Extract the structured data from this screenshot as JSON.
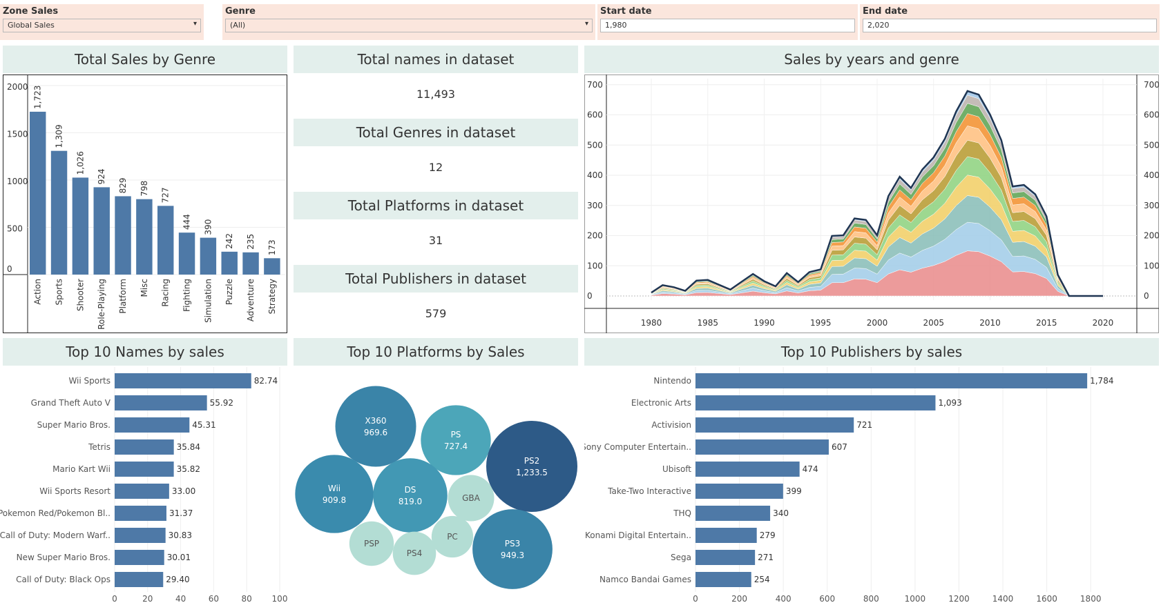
{
  "filters": {
    "zone": {
      "label": "Zone Sales",
      "value": "Global Sales"
    },
    "genre": {
      "label": "Genre",
      "value": "(All)"
    },
    "start": {
      "label": "Start date",
      "value": "1,980"
    },
    "end": {
      "label": "End date",
      "value": "2,020"
    }
  },
  "panels": {
    "genre_title": "Total Sales by Genre",
    "names_title": "Total names in dataset",
    "names_value": "11,493",
    "genres_title": "Total Genres in dataset",
    "genres_value": "12",
    "platforms_title": "Total Platforms in dataset",
    "platforms_value": "31",
    "publishers_title": "Total Publishers in dataset",
    "publishers_value": "579",
    "years_title": "Sales by years and genre",
    "top_names_title": "Top 10 Names by sales",
    "top_platforms_title": "Top 10 Platforms by Sales",
    "top_publishers_title": "Top 10 Publishers by sales"
  },
  "colors": {
    "bar": "#4e79a7",
    "title_bg": "#e3efec",
    "filter_bg": "#fbe6dd"
  },
  "chart_data": [
    {
      "id": "genre",
      "type": "bar",
      "categories": [
        "Action",
        "Sports",
        "Shooter",
        "Role-Playing",
        "Platform",
        "Misc",
        "Racing",
        "Fighting",
        "Simulation",
        "Puzzle",
        "Adventure",
        "Strategy"
      ],
      "values": [
        1723,
        1309,
        1026,
        924,
        829,
        798,
        727,
        444,
        390,
        242,
        235,
        173
      ],
      "value_labels": [
        "1,723",
        "1,309",
        "1,026",
        "924",
        "829",
        "798",
        "727",
        "444",
        "390",
        "242",
        "235",
        "173"
      ],
      "yticks": [
        "0",
        "500",
        "1000",
        "1500",
        "2000"
      ],
      "ylim": [
        0,
        2000
      ]
    },
    {
      "id": "years",
      "type": "area",
      "x": [
        1980,
        1981,
        1982,
        1983,
        1984,
        1985,
        1986,
        1987,
        1988,
        1989,
        1990,
        1991,
        1992,
        1993,
        1994,
        1995,
        1996,
        1997,
        1998,
        1999,
        2000,
        2001,
        2002,
        2003,
        2004,
        2005,
        2006,
        2007,
        2008,
        2009,
        2010,
        2011,
        2012,
        2013,
        2014,
        2015,
        2016,
        2017,
        2018,
        2019,
        2020
      ],
      "total": [
        11,
        36,
        29,
        17,
        51,
        53,
        37,
        21,
        47,
        73,
        49,
        32,
        76,
        46,
        79,
        88,
        199,
        201,
        257,
        252,
        201,
        331,
        395,
        358,
        419,
        459,
        521,
        611,
        679,
        667,
        601,
        516,
        363,
        368,
        337,
        264,
        70,
        0,
        0,
        0,
        0
      ],
      "series_shares": [
        0.22,
        0.14,
        0.13,
        0.1,
        0.09,
        0.08,
        0.07,
        0.06,
        0.05,
        0.04,
        0.02
      ],
      "series_colors": [
        "#e9898a",
        "#a0cbe8",
        "#86bcb6",
        "#f1ce63",
        "#8cd17d",
        "#b6992d",
        "#ffbe7d",
        "#f28e2b",
        "#59a14f",
        "#bab0ac",
        "#9fc5e8"
      ],
      "top_color": "#8fa9cb",
      "xticks": [
        "1980",
        "1985",
        "1990",
        "1995",
        "2000",
        "2005",
        "2010",
        "2015",
        "2020"
      ],
      "yticks": [
        "0",
        "100",
        "200",
        "300",
        "400",
        "500",
        "600",
        "700"
      ],
      "xlim": [
        1977,
        2023
      ],
      "ylim": [
        0,
        720
      ]
    },
    {
      "id": "top_names",
      "type": "bar",
      "categories": [
        "Wii Sports",
        "Grand Theft Auto V",
        "Super Mario Bros.",
        "Tetris",
        "Mario Kart Wii",
        "Wii Sports Resort",
        "Pokemon Red/Pokemon Bl..",
        "Call of Duty: Modern Warf..",
        "New Super Mario Bros.",
        "Call of Duty: Black Ops"
      ],
      "values": [
        82.74,
        55.92,
        45.31,
        35.84,
        35.82,
        33.0,
        31.37,
        30.83,
        30.01,
        29.4
      ],
      "value_labels": [
        "82.74",
        "55.92",
        "45.31",
        "35.84",
        "35.82",
        "33.00",
        "31.37",
        "30.83",
        "30.01",
        "29.40"
      ],
      "xticks": [
        "0",
        "20",
        "40",
        "60",
        "80",
        "100"
      ],
      "xlim": [
        0,
        100
      ]
    },
    {
      "id": "top_platforms",
      "type": "bubble",
      "items": [
        {
          "name": "X360",
          "value_label": "969.6",
          "value": 969.6,
          "color": "#3a84a8"
        },
        {
          "name": "PS",
          "value_label": "727.4",
          "value": 727.4,
          "color": "#4ca6b9"
        },
        {
          "name": "PS2",
          "value_label": "1,233.5",
          "value": 1233.5,
          "color": "#2d5a87"
        },
        {
          "name": "Wii",
          "value_label": "909.8",
          "value": 909.8,
          "color": "#3a8bad"
        },
        {
          "name": "DS",
          "value_label": "819.0",
          "value": 819.0,
          "color": "#4298b4"
        },
        {
          "name": "GBA",
          "value_label": "",
          "value": 318,
          "color": "#b3ddd4"
        },
        {
          "name": "PC",
          "value_label": "",
          "value": 258,
          "color": "#b3ddd4"
        },
        {
          "name": "PSP",
          "value_label": "",
          "value": 294,
          "color": "#b3ddd4"
        },
        {
          "name": "PS4",
          "value_label": "",
          "value": 278,
          "color": "#b3ddd4"
        },
        {
          "name": "PS3",
          "value_label": "949.3",
          "value": 949.3,
          "color": "#3a84a8"
        }
      ]
    },
    {
      "id": "top_publishers",
      "type": "bar",
      "categories": [
        "Nintendo",
        "Electronic Arts",
        "Activision",
        "Sony Computer Entertain..",
        "Ubisoft",
        "Take-Two Interactive",
        "THQ",
        "Konami Digital Entertain..",
        "Sega",
        "Namco Bandai Games"
      ],
      "values": [
        1784,
        1093,
        721,
        607,
        474,
        399,
        340,
        279,
        271,
        254
      ],
      "value_labels": [
        "1,784",
        "1,093",
        "721",
        "607",
        "474",
        "399",
        "340",
        "279",
        "271",
        "254"
      ],
      "xticks": [
        "0",
        "200",
        "400",
        "600",
        "800",
        "1000",
        "1200",
        "1400",
        "1600",
        "1800"
      ],
      "xlim": [
        0,
        1900
      ]
    }
  ]
}
